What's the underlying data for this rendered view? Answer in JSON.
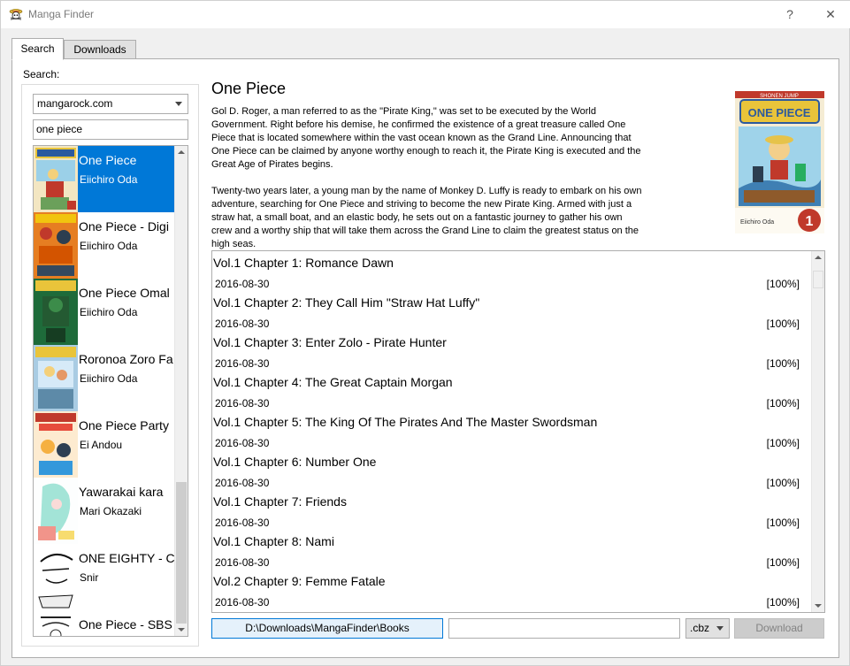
{
  "window": {
    "title": "Manga Finder",
    "help_glyph": "?",
    "close_glyph": "✕"
  },
  "tabs": [
    {
      "label": "Search",
      "active": true
    },
    {
      "label": "Downloads",
      "active": false
    }
  ],
  "search": {
    "label": "Search:",
    "source": "mangarock.com",
    "query": "one piece",
    "results": [
      {
        "title": "One Piece",
        "author": "Eiichiro Oda",
        "selected": true
      },
      {
        "title": "One Piece - Digi",
        "author": "Eiichiro Oda",
        "selected": false
      },
      {
        "title": "One Piece Omal",
        "author": "Eiichiro Oda",
        "selected": false
      },
      {
        "title": "Roronoa Zoro Fa",
        "author": "Eiichiro Oda",
        "selected": false
      },
      {
        "title": "One Piece Party",
        "author": "Ei Andou",
        "selected": false
      },
      {
        "title": "Yawarakai kara",
        "author": "Mari Okazaki",
        "selected": false
      },
      {
        "title": "ONE EIGHTY - C",
        "author": "Snir",
        "selected": false
      },
      {
        "title": "One Piece - SBS",
        "author": "",
        "selected": false
      }
    ]
  },
  "details": {
    "title": "One Piece",
    "synopsis": [
      "Gol D. Roger, a man referred to as the \"Pirate King,\" was set to be executed by the World Government. Right before his demise, he confirmed the existence of a great treasure called One Piece that is located somewhere within the vast ocean known as the Grand Line. Announcing that One Piece can be claimed by anyone worthy enough to reach it, the Pirate King is executed and the Great Age of Pirates begins.",
      "Twenty-two years later, a young man by the name of Monkey D. Luffy is ready to embark on his own adventure, searching for One Piece and striving to become the new Pirate King. Armed with just a straw hat, a small boat, and an elastic body, he sets out on a fantastic journey to gather his own crew and a worthy ship that will take them across the Grand Line to claim the greatest status on the high seas."
    ],
    "cover_logo": "ONE PIECE",
    "cover_top": "SHONEN JUMP",
    "cover_bottom": "Eiichiro Oda",
    "cover_volume": "1"
  },
  "chapters": [
    {
      "title": "Vol.1 Chapter 1: Romance Dawn",
      "date": "2016-08-30",
      "progress": "[100%]"
    },
    {
      "title": "Vol.1 Chapter 2: They Call Him \"Straw Hat Luffy\"",
      "date": "2016-08-30",
      "progress": "[100%]"
    },
    {
      "title": "Vol.1 Chapter 3: Enter Zolo - Pirate Hunter",
      "date": "2016-08-30",
      "progress": "[100%]"
    },
    {
      "title": "Vol.1 Chapter 4: The Great Captain Morgan",
      "date": "2016-08-30",
      "progress": "[100%]"
    },
    {
      "title": "Vol.1 Chapter 5: The King Of The Pirates And The Master Swordsman",
      "date": "2016-08-30",
      "progress": "[100%]"
    },
    {
      "title": "Vol.1 Chapter 6: Number One",
      "date": "2016-08-30",
      "progress": "[100%]"
    },
    {
      "title": "Vol.1 Chapter 7: Friends",
      "date": "2016-08-30",
      "progress": "[100%]"
    },
    {
      "title": "Vol.1 Chapter 8: Nami",
      "date": "2016-08-30",
      "progress": "[100%]"
    },
    {
      "title": "Vol.2 Chapter 9: Femme Fatale",
      "date": "2016-08-30",
      "progress": "[100%]"
    }
  ],
  "footer": {
    "directory": "D:\\Downloads\\MangaFinder\\Books",
    "filename": "",
    "format": ".cbz",
    "download_label": "Download"
  },
  "colors": {
    "selection": "#0078d7",
    "button_focus_bg": "#e5f1fb",
    "disabled_text": "#838383"
  },
  "icons": [
    "straw-hat-jolly-roger-icon",
    "help-icon",
    "close-icon",
    "chevron-down-icon"
  ]
}
